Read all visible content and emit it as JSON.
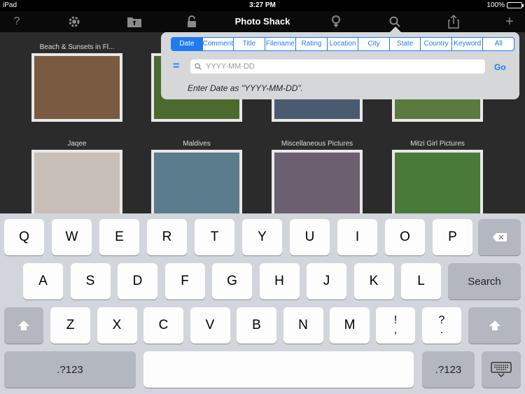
{
  "status": {
    "carrier": "iPad",
    "time": "3:27 PM",
    "battery": "100%"
  },
  "toolbar": {
    "title": "Photo Shack",
    "icons": [
      "help-icon",
      "gear-icon",
      "folder-upload-icon",
      "lock-icon",
      "filter-icon",
      "search-icon",
      "share-icon",
      "plus-icon"
    ]
  },
  "albums": [
    {
      "label": "Beach & Sunsets in Fl...",
      "color": "#7a5a40"
    },
    {
      "label": "",
      "color": "#4c6a2e"
    },
    {
      "label": "",
      "color": "#4a5a70"
    },
    {
      "label": "",
      "color": "#5a7a40"
    },
    {
      "label": "Jaqee",
      "color": "#c8c0b8"
    },
    {
      "label": "Maldives",
      "color": "#5a7c8c"
    },
    {
      "label": "Miscellaneous Pictures",
      "color": "#6a6070"
    },
    {
      "label": "Mitzi Girl Pictures",
      "color": "#4a7a3a"
    }
  ],
  "popover": {
    "filters": [
      "Date",
      "Comment",
      "Title",
      "Filename",
      "Rating",
      "Location",
      "City",
      "State",
      "Country",
      "Keyword",
      "All"
    ],
    "active_filter": "Date",
    "operator": "=",
    "placeholder": "YYYY-MM-DD",
    "go_label": "Go",
    "hint": "Enter Date as \"YYYY-MM-DD\"."
  },
  "keyboard": {
    "row1": [
      "Q",
      "W",
      "E",
      "R",
      "T",
      "Y",
      "U",
      "I",
      "O",
      "P"
    ],
    "row2": [
      "A",
      "S",
      "D",
      "F",
      "G",
      "H",
      "J",
      "K",
      "L"
    ],
    "row3": [
      "Z",
      "X",
      "C",
      "V",
      "B",
      "N",
      "M"
    ],
    "punct1": [
      "!",
      ","
    ],
    "punct2": [
      "?",
      "."
    ],
    "search_label": "Search",
    "numbers_label": ".?123"
  }
}
